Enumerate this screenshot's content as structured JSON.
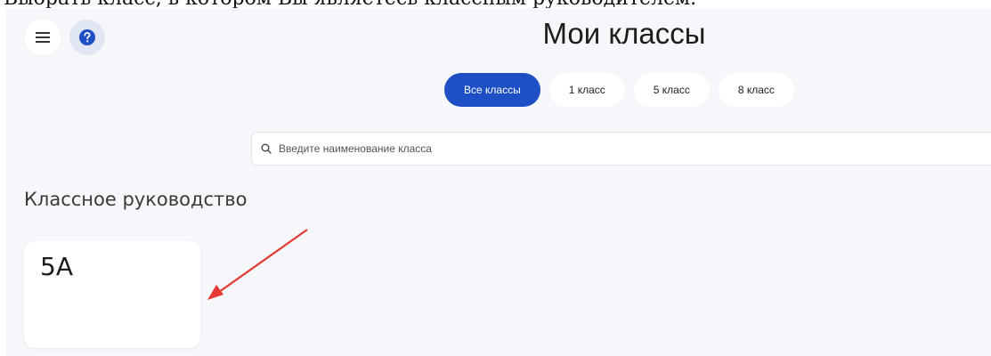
{
  "caption": "Выбрать класс, в котором Вы являетесь классным руководителем.",
  "header": {
    "menu_icon": "hamburger-menu-icon",
    "help_icon": "question-mark-icon",
    "title": "Мои классы"
  },
  "filters": {
    "tabs": [
      {
        "label": "Все классы",
        "active": true
      },
      {
        "label": "1 класс",
        "active": false
      },
      {
        "label": "5 класс",
        "active": false
      },
      {
        "label": "8 класс",
        "active": false
      }
    ]
  },
  "search": {
    "placeholder": "Введите наименование класса",
    "value": ""
  },
  "section": {
    "title": "Классное руководство",
    "classes": [
      {
        "name": "5А"
      }
    ]
  },
  "colors": {
    "accent": "#1f4fc4",
    "annotation_arrow": "#e53935",
    "background": "#f5f7fa"
  }
}
